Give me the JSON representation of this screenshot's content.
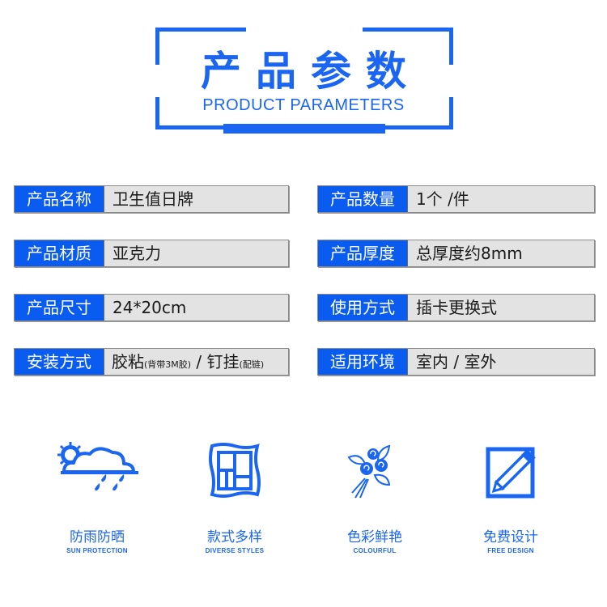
{
  "header": {
    "title_cn": "产品参数",
    "title_en": "PRODUCT PARAMETERS",
    "accent_color": "#1a66f2"
  },
  "params": {
    "left": [
      {
        "label": "产品名称",
        "value": "卫生值日牌"
      },
      {
        "label": "产品材质",
        "value": "亚克力"
      },
      {
        "label": "产品尺寸",
        "value": "24*20cm"
      },
      {
        "label": "安装方式",
        "value_main1": "胶粘",
        "value_note1": "(背带3M胶)",
        "value_sep": " / ",
        "value_main2": "钉挂",
        "value_note2": "(配链)"
      }
    ],
    "right": [
      {
        "label": "产品数量",
        "value": "1个 /件"
      },
      {
        "label": "产品厚度",
        "value": "总厚度约8mm"
      },
      {
        "label": "使用方式",
        "value": "插卡更换式"
      },
      {
        "label": "适用环境",
        "value": "室内 / 室外"
      }
    ]
  },
  "features": [
    {
      "icon": "sun-rain-cloud-icon",
      "cn": "防雨防晒",
      "en": "SUN PROTECTION"
    },
    {
      "icon": "picture-frame-icon",
      "cn": "款式多样",
      "en": "DIVERSE STYLES"
    },
    {
      "icon": "flower-bouquet-icon",
      "cn": "色彩鲜艳",
      "en": "COLOURFUL"
    },
    {
      "icon": "pencil-edit-icon",
      "cn": "免费设计",
      "en": "FREE DESIGN"
    }
  ]
}
